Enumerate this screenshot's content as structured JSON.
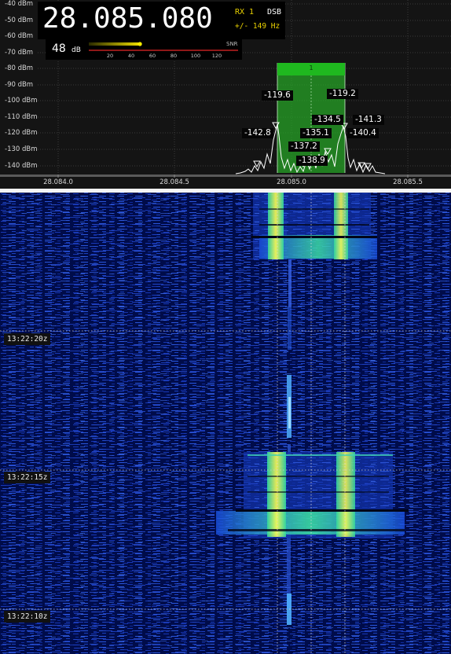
{
  "vfo": {
    "frequency": "28.085.080",
    "rx_label": "RX 1",
    "mode": "DSB",
    "bandwidth_offset": "+/- 149 Hz"
  },
  "snr_meter": {
    "value": "48",
    "unit": "dB",
    "label": "SNR",
    "scale": [
      "20",
      "40",
      "60",
      "80",
      "100",
      "120"
    ],
    "level_db": 48
  },
  "spectrum": {
    "dbm_labels": [
      "-40 dBm",
      "-50 dBm",
      "-60 dBm",
      "-70 dBm",
      "-80 dBm",
      "-90 dBm",
      "-100 dBm",
      "-110 dBm",
      "-120 dBm",
      "-130 dBm",
      "-140 dBm"
    ],
    "freq_ticks": [
      "28.084.0",
      "28.084.5",
      "28.085.0",
      "28.085.5"
    ],
    "rx_badge": "1",
    "peak_labels": [
      "-119.6",
      "-119.2",
      "-142.8",
      "-134.5",
      "-141.3",
      "-135.1",
      "-140.4",
      "-137.2",
      "-138.9"
    ],
    "colors": {
      "passband": "#27a827",
      "trace": "#ffffff",
      "rx_accent": "#e8d000"
    }
  },
  "waterfall": {
    "timestamps": [
      "13:22:20z",
      "13:22:15z",
      "13:22:10z"
    ],
    "colors": {
      "background": "#000c4a",
      "hot": "#ffff40",
      "mid": "#30e080"
    }
  }
}
